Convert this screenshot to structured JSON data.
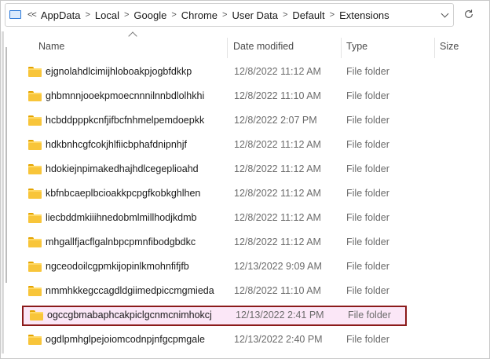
{
  "address": {
    "lead": "<<",
    "crumbs": [
      "AppData",
      "Local",
      "Google",
      "Chrome",
      "User Data",
      "Default",
      "Extensions"
    ],
    "sep": ">"
  },
  "columns": {
    "name": "Name",
    "date": "Date modified",
    "type": "Type",
    "size": "Size"
  },
  "rows": [
    {
      "name": "ejgnolahdlcimijhloboakpjogbfdkkp",
      "date": "12/8/2022 11:12 AM",
      "type": "File folder"
    },
    {
      "name": "ghbmnnjooekpmoecnnnilnnbdlolhkhi",
      "date": "12/8/2022 11:10 AM",
      "type": "File folder"
    },
    {
      "name": "hcbddpppkcnfjifbcfnhmelpemdoepkk",
      "date": "12/8/2022 2:07 PM",
      "type": "File folder"
    },
    {
      "name": "hdkbnhcgfcokjhlfiicbphafdnipnhjf",
      "date": "12/8/2022 11:12 AM",
      "type": "File folder"
    },
    {
      "name": "hdokiejnpimakedhajhdlcegeplioahd",
      "date": "12/8/2022 11:12 AM",
      "type": "File folder"
    },
    {
      "name": "kbfnbcaeplbcioakkpcpgfkobkghlhen",
      "date": "12/8/2022 11:12 AM",
      "type": "File folder"
    },
    {
      "name": "liecbddmkiiihnedobmlmillhodjkdmb",
      "date": "12/8/2022 11:12 AM",
      "type": "File folder"
    },
    {
      "name": "mhgallfjacflgalnbpcpmnfibodgbdkc",
      "date": "12/8/2022 11:12 AM",
      "type": "File folder"
    },
    {
      "name": "ngceodoilcgpmkijopinlkmohnfifjfb",
      "date": "12/13/2022 9:09 AM",
      "type": "File folder"
    },
    {
      "name": "nmmhkkegccagdldgiimedpiccmgmieda",
      "date": "12/8/2022 11:10 AM",
      "type": "File folder"
    },
    {
      "name": "ogccgbmabaphcakpiclgcnmcnimhokcj",
      "date": "12/13/2022 2:41 PM",
      "type": "File folder"
    },
    {
      "name": "ogdlpmhglpejoiomcodnpjnfgcpmgale",
      "date": "12/13/2022 2:40 PM",
      "type": "File folder"
    }
  ],
  "highlight_color": "#8b1a1a",
  "highlight_fill": "#fbe7f7",
  "folder_color": "#f8c53a",
  "icons": {
    "folder": "folder-icon",
    "refresh": "refresh-icon",
    "pc": "this-pc-icon",
    "dropdown": "chevron-down-icon",
    "sort": "sort-up-icon"
  }
}
